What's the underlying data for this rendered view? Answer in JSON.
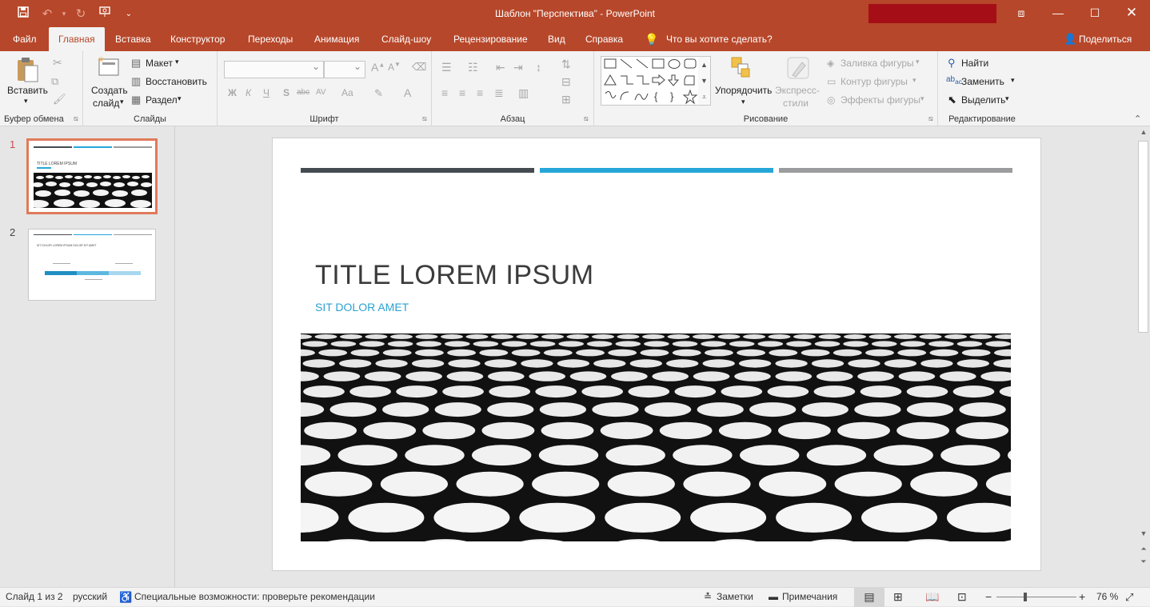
{
  "window": {
    "title": "Шаблон \"Перспектива\"  -  PowerPoint"
  },
  "qat": {
    "icons": [
      "save-icon",
      "undo-icon",
      "redo-icon",
      "present-icon",
      "customize-icon"
    ]
  },
  "tabs": {
    "file": "Файл",
    "home": "Главная",
    "insert": "Вставка",
    "design": "Конструктор",
    "transitions": "Переходы",
    "animations": "Анимация",
    "slideshow": "Слайд-шоу",
    "review": "Рецензирование",
    "view": "Вид",
    "help": "Справка",
    "tellme": "Что вы хотите сделать?",
    "share": "Поделиться"
  },
  "ribbon": {
    "clipboard": {
      "paste": "Вставить",
      "label": "Буфер обмена"
    },
    "slides": {
      "new1": "Создать",
      "new2": "слайд",
      "layout": "Макет",
      "reset": "Восстановить",
      "section": "Раздел",
      "label": "Слайды"
    },
    "font": {
      "bold": "Ж",
      "italic": "К",
      "underline": "Ч",
      "shadow": "S",
      "strike": "abc",
      "spacing": "AV",
      "case": "Aa",
      "clear": "A",
      "label": "Шрифт"
    },
    "paragraph": {
      "label": "Абзац"
    },
    "drawing": {
      "arrange": "Упорядочить",
      "styles1": "Экспресс-",
      "styles2": "стили",
      "fill": "Заливка фигуры",
      "outline": "Контур фигуры",
      "effects": "Эффекты фигуры",
      "label": "Рисование"
    },
    "editing": {
      "find": "Найти",
      "replace": "Заменить",
      "select": "Выделить",
      "label": "Редактирование"
    }
  },
  "thumbnails": [
    {
      "num": "1",
      "title": "TITLE LOREM IPSUM"
    },
    {
      "num": "2",
      "title": "SIT DOLOR LOREM IPSUM DOLOR SIT AMET"
    }
  ],
  "slide": {
    "title": "TITLE LOREM IPSUM",
    "subtitle": "SIT DOLOR AMET",
    "bar_colors": [
      "#444c52",
      "#26a7d8",
      "#9a9c9e"
    ]
  },
  "status": {
    "slide_of": "Слайд 1 из 2",
    "language": "русский",
    "accessibility": "Специальные возможности: проверьте рекомендации",
    "notes": "Заметки",
    "comments": "Примечания",
    "zoom": "76 %"
  }
}
